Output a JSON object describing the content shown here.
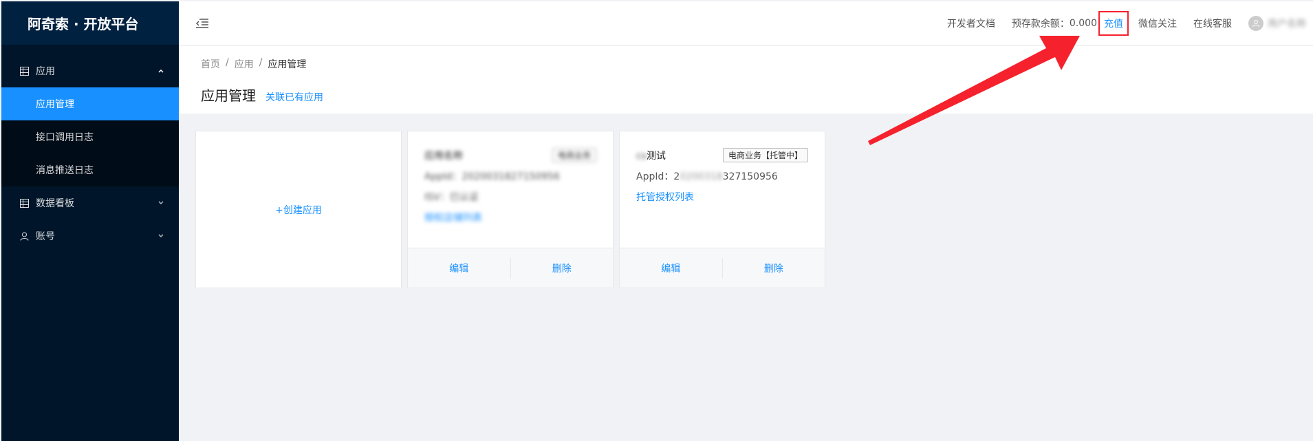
{
  "sidebar": {
    "logo": "阿奇索 · 开放平台",
    "items": [
      {
        "label": "应用",
        "icon": "grid-icon",
        "expanded": true,
        "children": [
          {
            "label": "应用管理",
            "active": true
          },
          {
            "label": "接口调用日志"
          },
          {
            "label": "消息推送日志"
          }
        ]
      },
      {
        "label": "数据看板",
        "icon": "grid-icon"
      },
      {
        "label": "账号",
        "icon": "user-icon"
      }
    ]
  },
  "header": {
    "links": {
      "dev_docs": "开发者文档",
      "balance_label": "预存款余额：",
      "balance_value": "0.000",
      "recharge": "充值",
      "wechat": "微信关注",
      "support": "在线客服"
    },
    "user_name": "用户名称"
  },
  "page": {
    "breadcrumb": [
      "首页",
      "应用",
      "应用管理"
    ],
    "title": "应用管理",
    "related_link": "关联已有应用"
  },
  "cards": {
    "create_label": "+创建应用",
    "app1": {
      "name": "应用名称",
      "tag": "电商业务",
      "appid": "AppId：2020031827150956",
      "line": "ISV：已认证",
      "link": "授权店铺列表",
      "edit": "编辑",
      "delete": "删除"
    },
    "app2": {
      "name": "测试",
      "tag": "电商业务【托管中】",
      "appid_prefix": "AppId：2",
      "appid_hidden": "0200318",
      "appid_suffix": "327150956",
      "link": "托管授权列表",
      "edit": "编辑",
      "delete": "删除"
    }
  },
  "colors": {
    "sidebar_bg": "#001529",
    "accent": "#1890ff",
    "highlight_red": "#f5222d"
  }
}
